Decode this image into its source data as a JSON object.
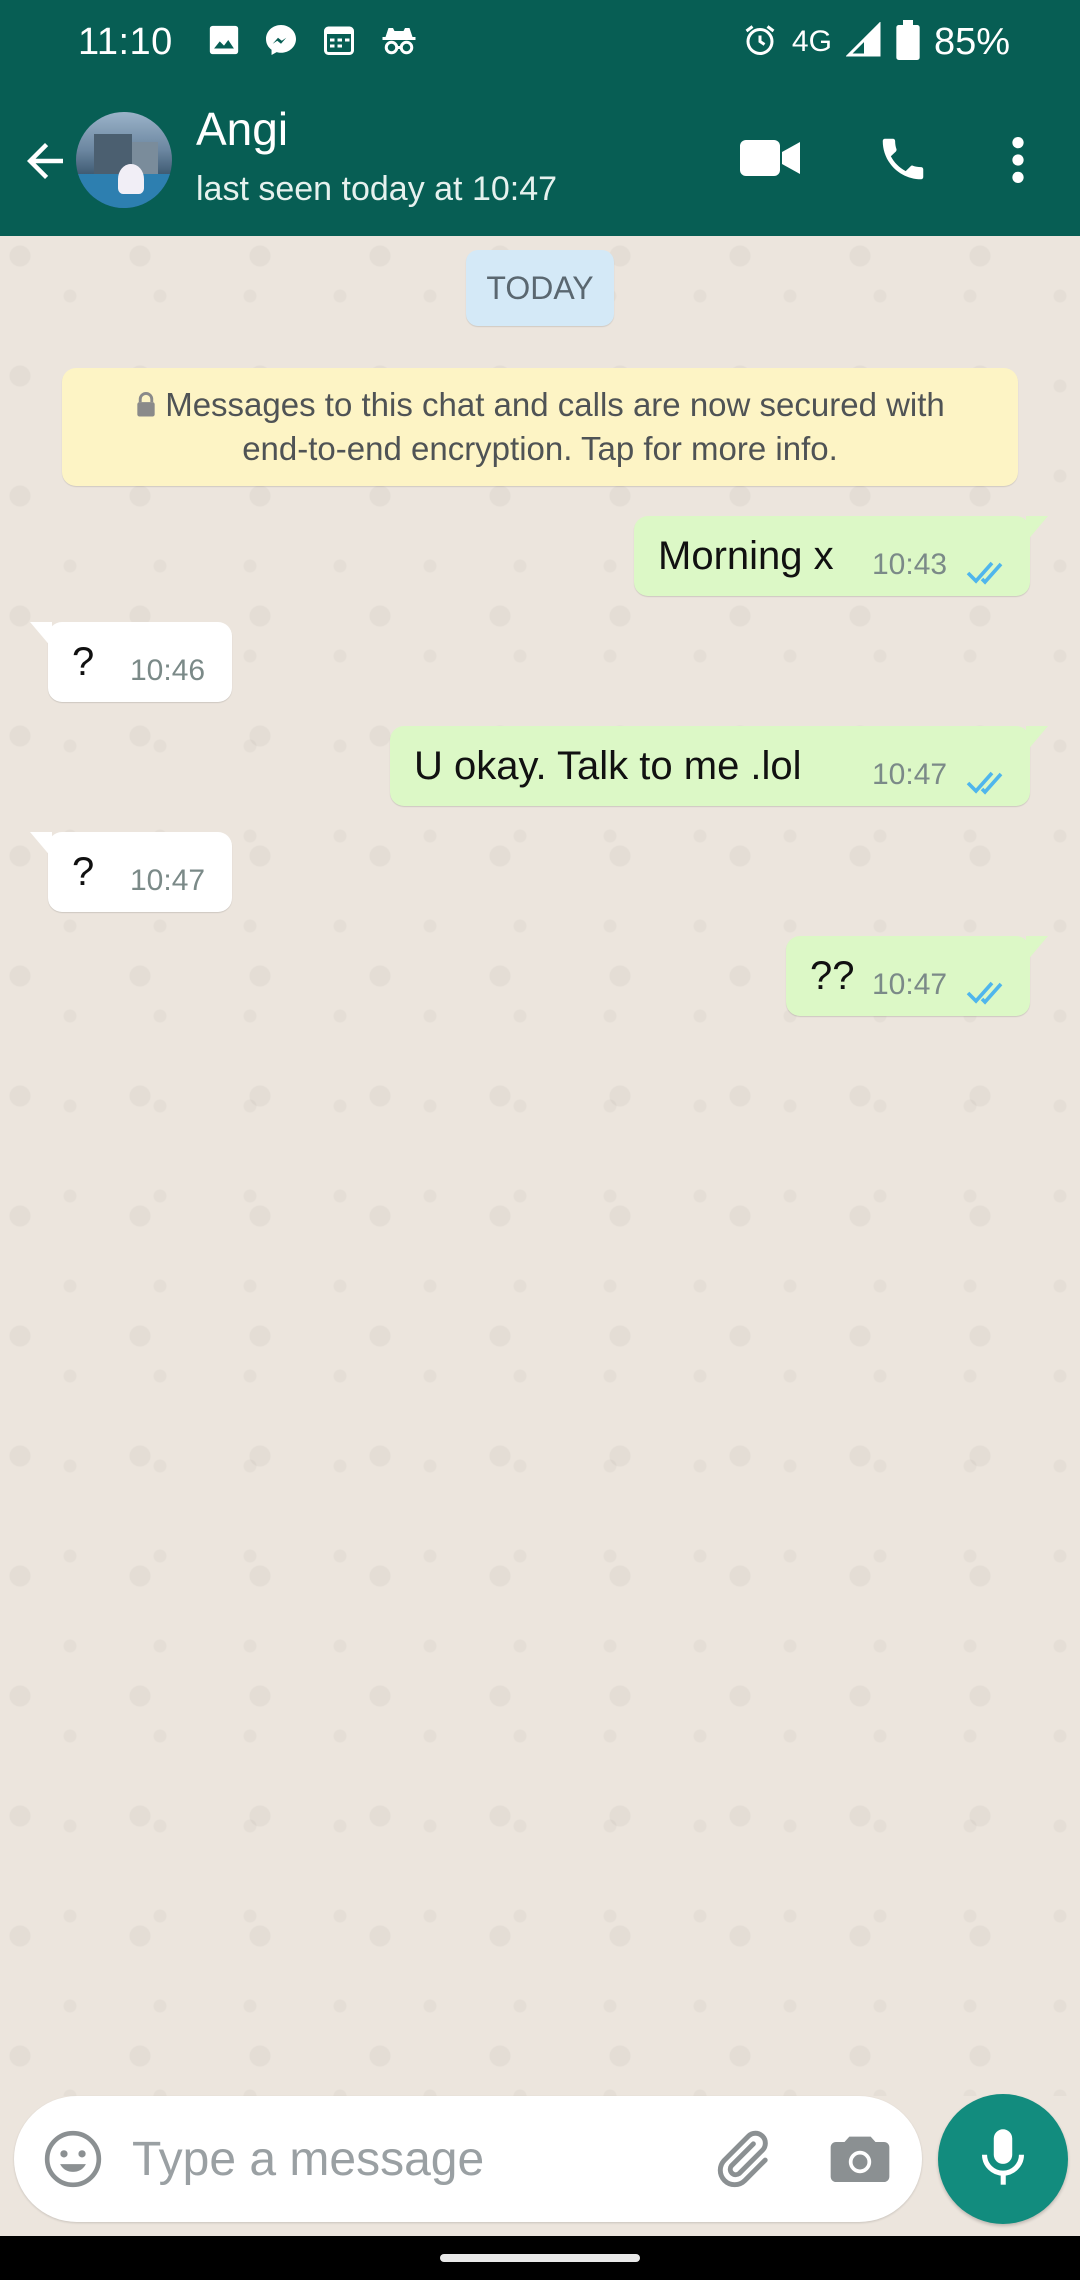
{
  "status_bar": {
    "time": "11:10",
    "network": "4G",
    "battery": "85%",
    "left_icons": [
      "image-icon",
      "messenger-icon",
      "calendar-icon",
      "incognito-icon"
    ],
    "right_icons": [
      "alarm-icon",
      "signal-icon",
      "battery-icon"
    ]
  },
  "header": {
    "contact_name": "Angi",
    "last_seen": "last seen today at 10:47",
    "actions": [
      "video-call-icon",
      "voice-call-icon",
      "more-options-icon"
    ]
  },
  "chat": {
    "date_chip": "TODAY",
    "encryption_notice_line1": "Messages to this chat and calls are now secured with",
    "encryption_notice_line2": "end-to-end encryption. Tap for more info.",
    "messages": [
      {
        "direction": "out",
        "text": "Morning x",
        "time": "10:43",
        "status": "read"
      },
      {
        "direction": "in",
        "text": "?",
        "time": "10:46"
      },
      {
        "direction": "out",
        "text": "U okay.  Talk to me .lol",
        "time": "10:47",
        "status": "read"
      },
      {
        "direction": "in",
        "text": "?",
        "time": "10:47"
      },
      {
        "direction": "out",
        "text": "??",
        "time": "10:47",
        "status": "read"
      }
    ]
  },
  "composer": {
    "placeholder": "Type a message"
  },
  "colors": {
    "header": "#075e54",
    "outgoing_bubble": "#dcf8c6",
    "incoming_bubble": "#ffffff",
    "read_ticks": "#4fb6ec",
    "mic_button": "#128c7e",
    "chat_background": "#ece5dd"
  }
}
